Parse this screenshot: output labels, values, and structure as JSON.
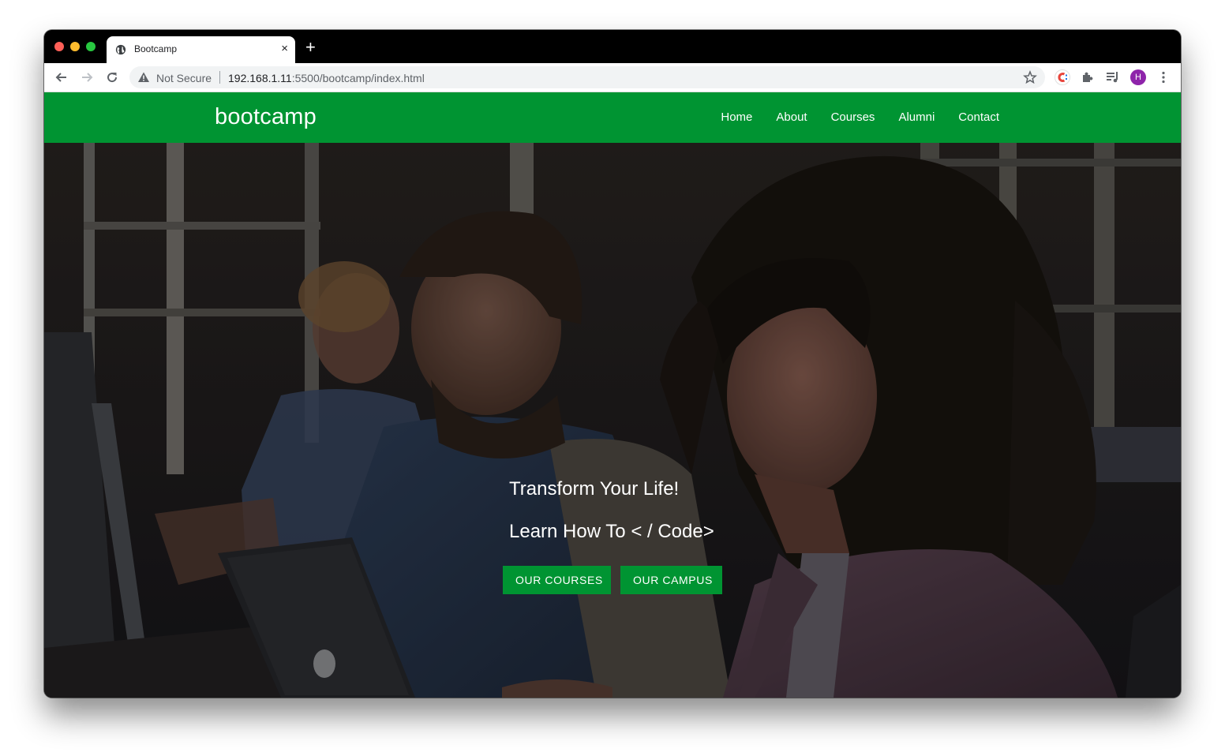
{
  "browser": {
    "tab_title": "Bootcamp",
    "tab_close": "×",
    "new_tab": "+",
    "security_label": "Not Secure",
    "url_host": "192.168.1.11",
    "url_path": ":5500/bootcamp/index.html",
    "profile_initial": "H"
  },
  "site": {
    "brand": "bootcamp",
    "brand_color": "#009432",
    "nav": [
      {
        "label": "Home"
      },
      {
        "label": "About"
      },
      {
        "label": "Courses"
      },
      {
        "label": "Alumni"
      },
      {
        "label": "Contact"
      }
    ]
  },
  "hero": {
    "headline": "Transform Your Life!",
    "subheadline": "Learn How To < / Code>",
    "buttons": [
      {
        "label": "OUR COURSES"
      },
      {
        "label": "OUR CAMPUS"
      }
    ]
  }
}
